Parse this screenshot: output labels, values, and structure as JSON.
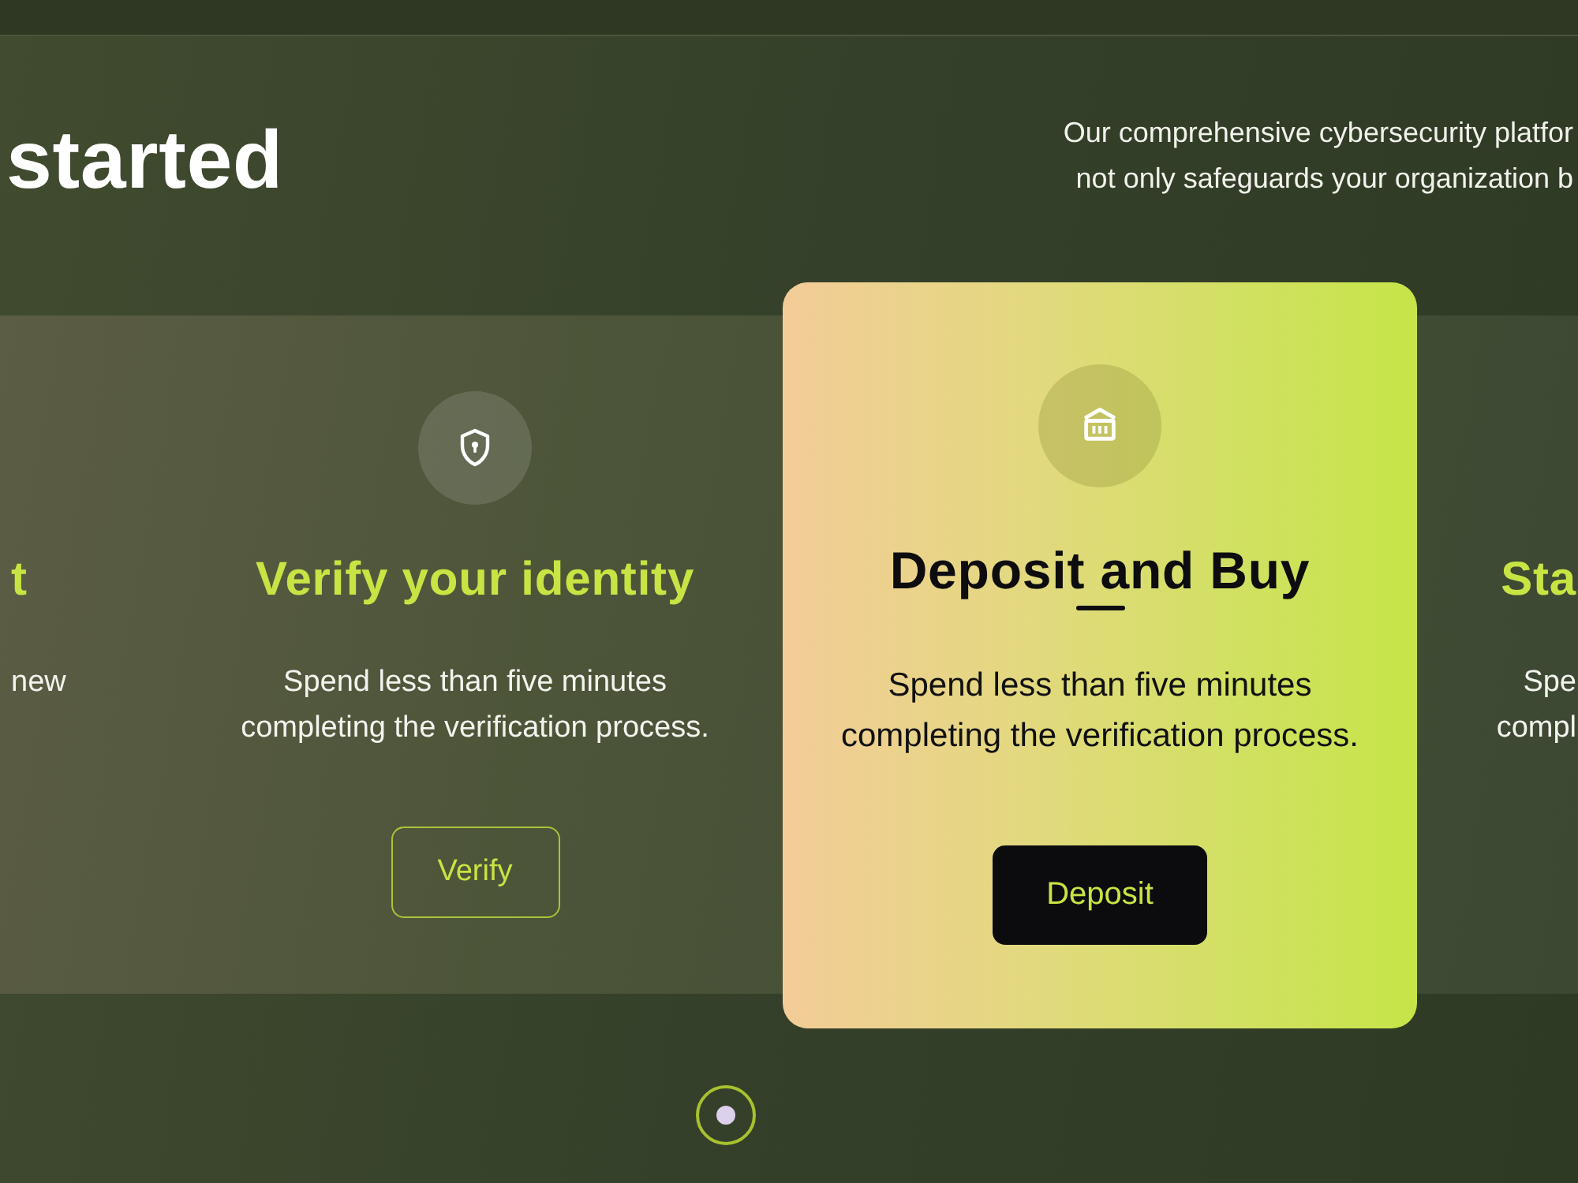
{
  "hero": {
    "heading": "started",
    "intro_lines": [
      "Our comprehensive cybersecurity platfor",
      "not only safeguards your organization b"
    ]
  },
  "steps": [
    {
      "kind": "clipped_start",
      "selected": false,
      "title": "t",
      "description_lines": [
        "new"
      ]
    },
    {
      "kind": "full",
      "selected": false,
      "title": "Verify your identity",
      "description_lines": [
        "Spend less than five minutes",
        "completing the verification process."
      ],
      "button": "Verify"
    },
    {
      "kind": "full",
      "selected": true,
      "title": "Deposit and Buy",
      "description_lines": [
        "Spend less than five minutes",
        "completing the verification process."
      ],
      "button": "Deposit"
    },
    {
      "kind": "clipped_end",
      "selected": false,
      "title": "Sta",
      "description_lines": [
        "Spe",
        "compl"
      ]
    }
  ],
  "pagination": [
    {
      "selected": true
    }
  ]
}
